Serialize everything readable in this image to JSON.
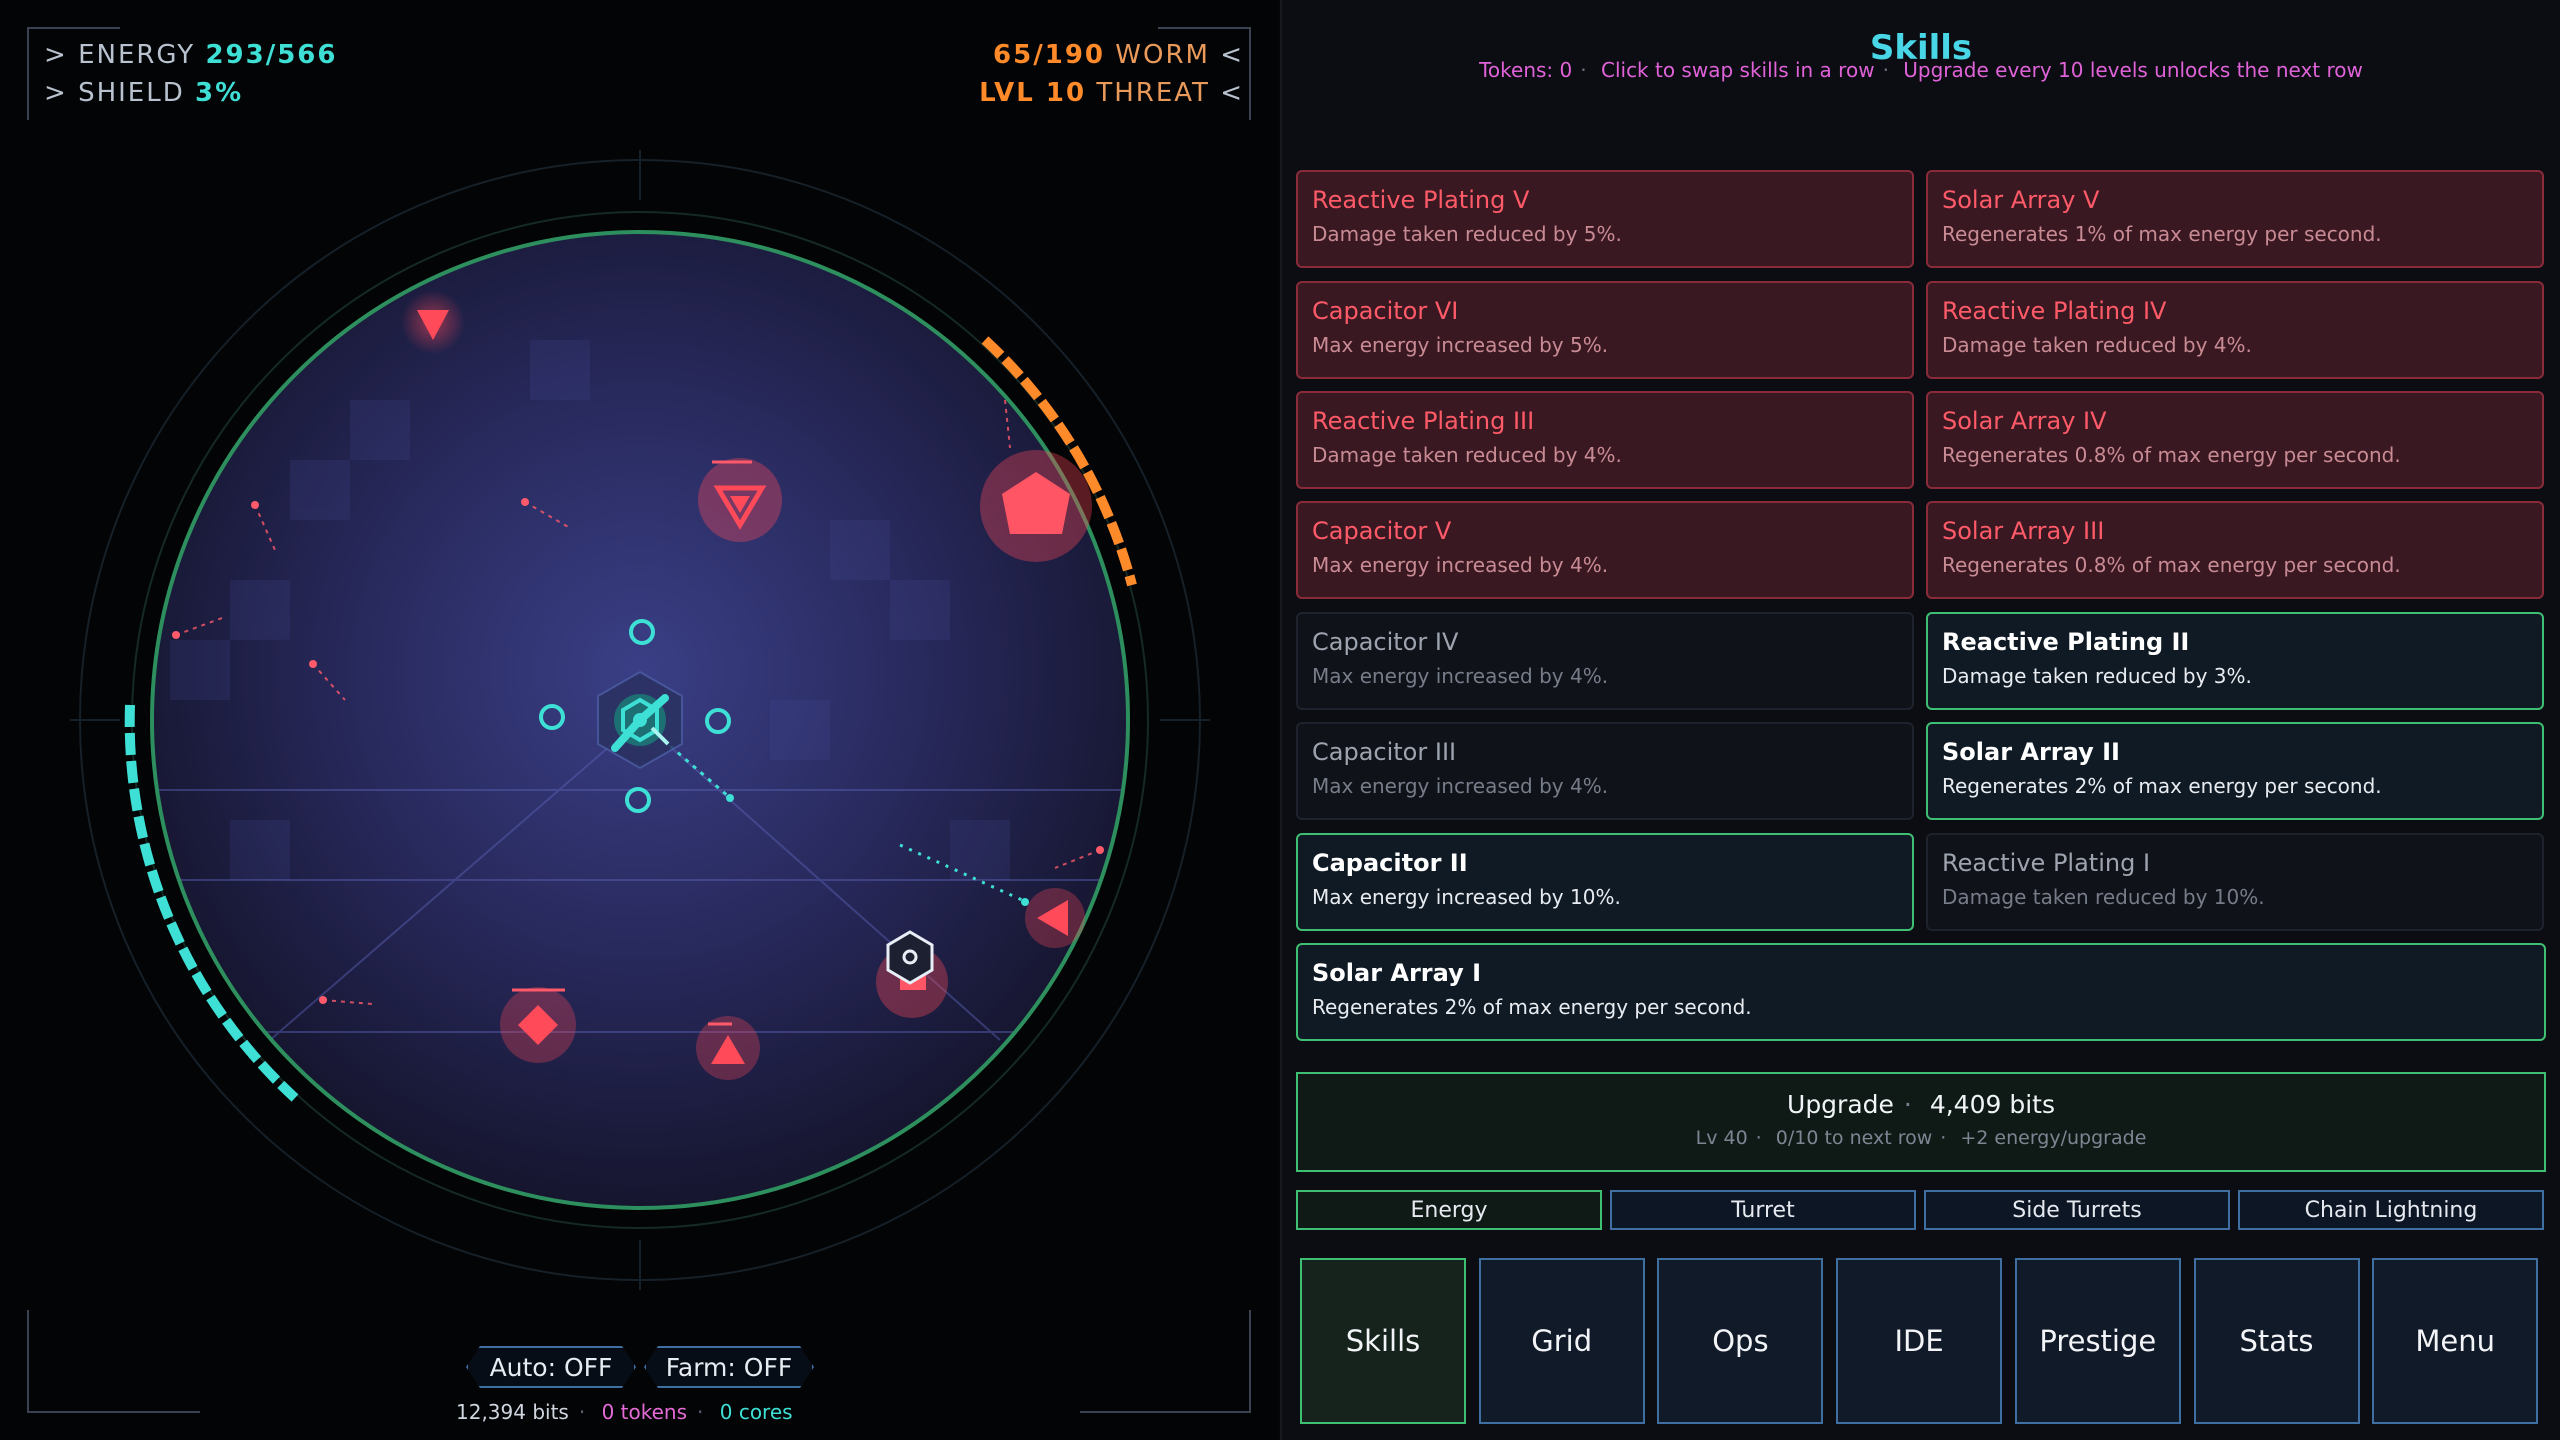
{
  "hud": {
    "energy_label": "ENERGY",
    "energy_value": "293/566",
    "shield_label": "SHIELD",
    "shield_value": "3%",
    "worm_value": "65/190",
    "worm_label": "WORM",
    "level_value": "LVL 10",
    "threat_label": "THREAT"
  },
  "toggles": {
    "auto": "Auto: OFF",
    "farm": "Farm: OFF"
  },
  "resources": {
    "bits": "12,394 bits",
    "tokens": "0 tokens",
    "cores": "0 cores"
  },
  "skills": {
    "title": "Skills",
    "subtitle_tokens": "Tokens: 0",
    "subtitle_swap": "Click to swap skills in a row",
    "subtitle_unlock": "Upgrade every 10 levels unlocks the next row",
    "cards": [
      {
        "name": "Reactive Plating V",
        "desc": "Damage taken reduced by 5%.",
        "state": "locked"
      },
      {
        "name": "Solar Array V",
        "desc": "Regenerates 1% of max energy per second.",
        "state": "locked"
      },
      {
        "name": "Capacitor VI",
        "desc": "Max energy increased by 5%.",
        "state": "locked"
      },
      {
        "name": "Reactive Plating IV",
        "desc": "Damage taken reduced by 4%.",
        "state": "locked"
      },
      {
        "name": "Reactive Plating III",
        "desc": "Damage taken reduced by 4%.",
        "state": "locked"
      },
      {
        "name": "Solar Array IV",
        "desc": "Regenerates 0.8% of max energy per second.",
        "state": "locked"
      },
      {
        "name": "Capacitor V",
        "desc": "Max energy increased by 4%.",
        "state": "locked"
      },
      {
        "name": "Solar Array III",
        "desc": "Regenerates 0.8% of max energy per second.",
        "state": "locked"
      },
      {
        "name": "Capacitor IV",
        "desc": "Max energy increased by 4%.",
        "state": "avail"
      },
      {
        "name": "Reactive Plating II",
        "desc": "Damage taken reduced by 3%.",
        "state": "active"
      },
      {
        "name": "Capacitor III",
        "desc": "Max energy increased by 4%.",
        "state": "avail"
      },
      {
        "name": "Solar Array II",
        "desc": "Regenerates 2% of max energy per second.",
        "state": "active"
      },
      {
        "name": "Capacitor II",
        "desc": "Max energy increased by 10%.",
        "state": "active"
      },
      {
        "name": "Reactive Plating I",
        "desc": "Damage taken reduced by 10%.",
        "state": "avail"
      },
      {
        "name": "Solar Array I",
        "desc": "Regenerates 2% of max energy per second.",
        "state": "active"
      }
    ]
  },
  "upgrade": {
    "label": "Upgrade",
    "cost": "4,409 bits",
    "level": "Lv 40",
    "progress": "0/10 to next row",
    "bonus": "+2 energy/upgrade"
  },
  "categories": [
    "Energy",
    "Turret",
    "Side Turrets",
    "Chain Lightning"
  ],
  "selected_category": "Energy",
  "nav": [
    "Skills",
    "Grid",
    "Ops",
    "IDE",
    "Prestige",
    "Stats",
    "Menu"
  ],
  "selected_nav": "Skills",
  "colors": {
    "accent_cyan": "#3ee0d6",
    "threat_orange": "#ff8a2a",
    "enemy_red": "#ff4a5a",
    "active_green": "#3fbf73",
    "locked_red": "#8a2b3a",
    "token_pink": "#e062d8"
  },
  "icons": [
    "core-turret-icon",
    "side-turret-icon",
    "enemy-triangle-icon",
    "enemy-pentagon-icon",
    "enemy-diamond-icon",
    "hex-target-icon"
  ]
}
